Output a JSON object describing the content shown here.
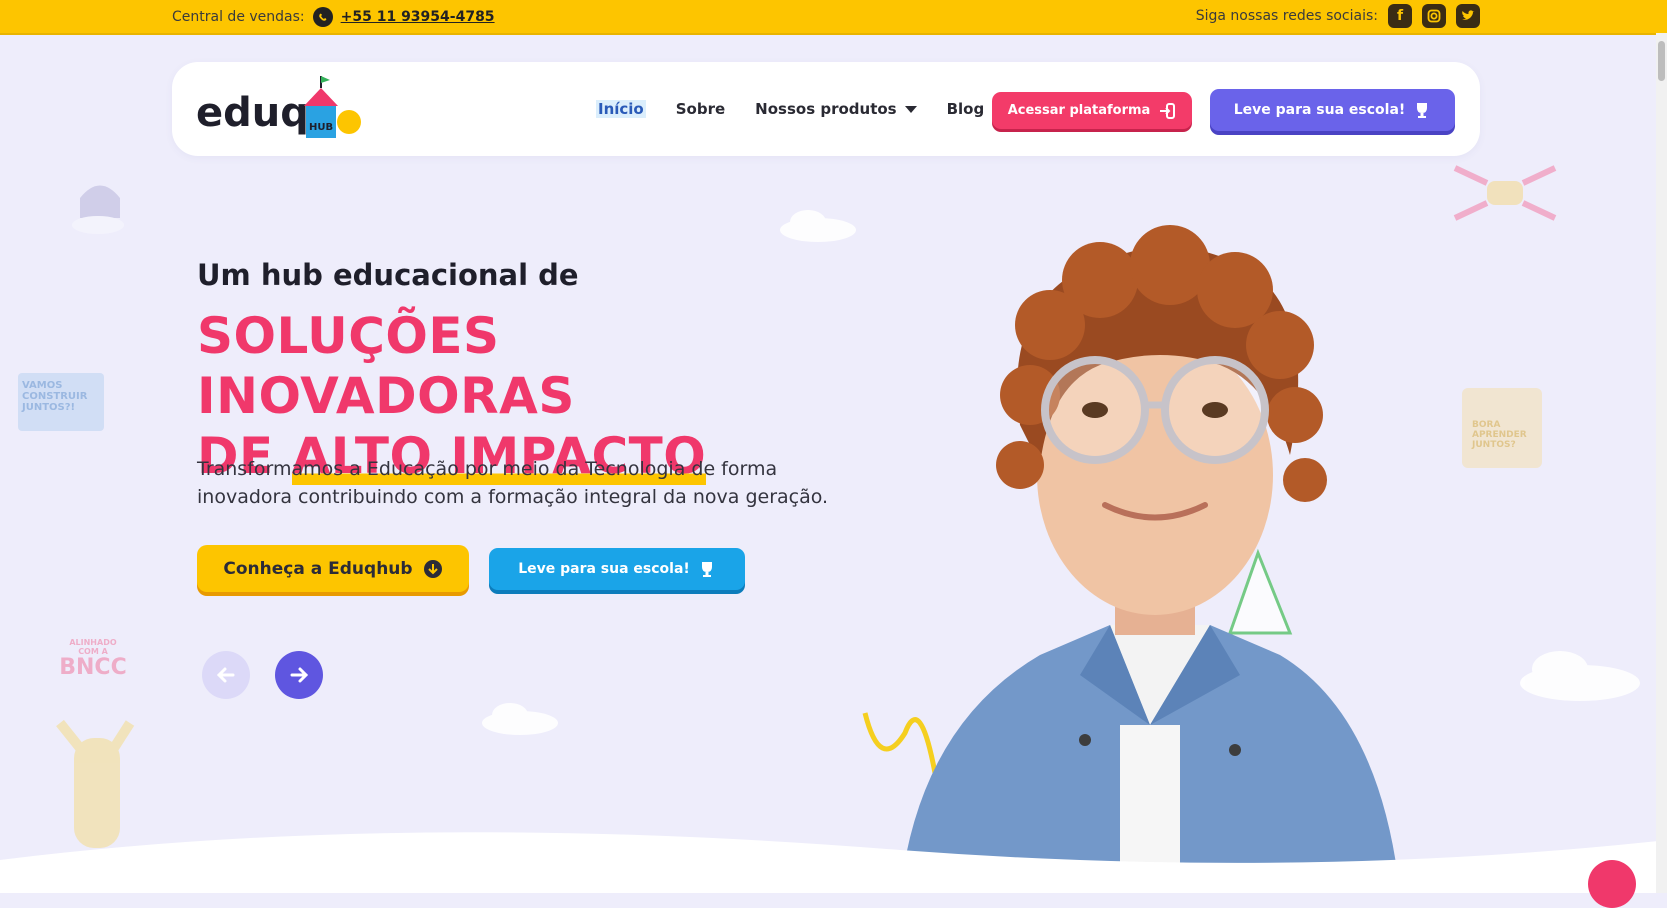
{
  "topbar": {
    "sales_label": "Central de vendas:",
    "phone": "+55 11 93954-4785",
    "social_label": "Siga nossas redes sociais:",
    "social_icons": [
      "facebook-icon",
      "instagram-icon",
      "twitter-icon"
    ]
  },
  "nav": {
    "logo_text": "eduq",
    "logo_badge": "HUB",
    "links": [
      "Início",
      "Sobre",
      "Nossos produtos",
      "Blog"
    ],
    "acessar_label": "Acessar plataforma",
    "leve_label": "Leve para sua escola!"
  },
  "hero": {
    "intro": "Um hub educacional de",
    "title_line1": "SOLUÇÕES INOVADORAS",
    "title_line2_a": "DE ",
    "title_line2_b": "ALTO IMPACTO",
    "description": "Transformamos a Educação por meio da Tecnologia de forma inovadora contribuindo com a formação integral da nova geração.",
    "conheca_label": "Conheça a Eduqhub",
    "leve_label": "Leve para sua escola!"
  },
  "decor": {
    "bncc_small": "ALINHADO COM A",
    "bncc": "BNCC",
    "vamos": "VAMOS CONSTRUIR JUNTOS?!",
    "right_card": "BORA APRENDER JUNTOS?"
  },
  "colors": {
    "topbar": "#fdc500",
    "accent_pink": "#f0386b",
    "accent_purple": "#6a63ea",
    "accent_blue": "#1aa4e8",
    "background": "#eeedfb"
  }
}
